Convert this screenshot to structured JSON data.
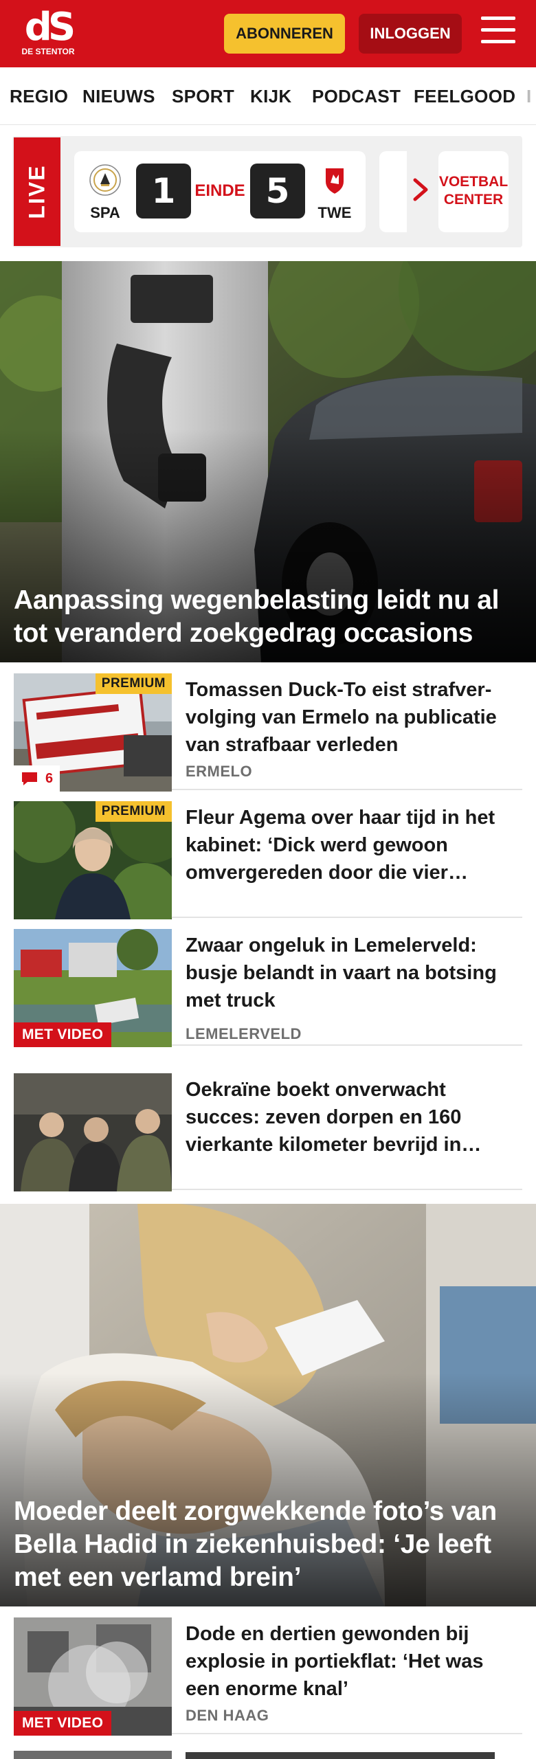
{
  "header": {
    "logo_mark": "dS",
    "logo_sub": "DE STENTOR",
    "subscribe_label": "ABONNEREN",
    "login_label": "INLOGGEN",
    "menu_icon": "hamburger-menu-icon"
  },
  "nav": {
    "items": [
      "REGIO",
      "NIEUWS",
      "SPORT",
      "KIJK",
      "PODCAST",
      "FEELGOOD",
      "I"
    ]
  },
  "live": {
    "label": "LIVE",
    "home_abbr": "SPA",
    "away_abbr": "TWE",
    "home_score": "1",
    "away_score": "5",
    "status": "EINDE",
    "voetbal_center_label": "VOETBAL CENTER",
    "arrow_icon": "chevron-right-icon"
  },
  "hero1": {
    "headline": "Aanpassing wegenbelasting leidt nu al tot veranderd zoekgedrag occasions"
  },
  "articles": [
    {
      "headline": "Tomassen Duck-To eist strafver­volging van Ermelo na publicatie van strafbaar verleden",
      "location": "ERMELO",
      "badge": "PREMIUM",
      "comments": "6"
    },
    {
      "headline": "Fleur Agema over haar tijd in het kabinet: ‘Dick werd gewoon omvergereden door die vier…",
      "badge": "PREMIUM"
    },
    {
      "headline": "Zwaar ongeluk in Lemelerveld: busje belandt in vaart na botsing met truck",
      "location": "LEMELERVELD",
      "video_label": "MET VIDEO"
    },
    {
      "headline": "Oekraïne boekt onverwacht succes: zeven dorpen en 160 vierkante kilometer bevrijd in…"
    }
  ],
  "hero2": {
    "headline": "Moeder deelt zorgwekkende foto’s van Bella Hadid in ziekenhuisbed: ‘Je leeft met een verlamd brein’"
  },
  "articles2": [
    {
      "headline": "Dode en dertien gewonden bij explosie in portiekflat: ‘Het was een enorme knal’",
      "location": "DEN HAAG",
      "video_label": "MET VIDEO"
    }
  ],
  "colors": {
    "brand_red": "#d3111a",
    "dark_red": "#a50d14",
    "premium_yellow": "#f5c12e"
  }
}
